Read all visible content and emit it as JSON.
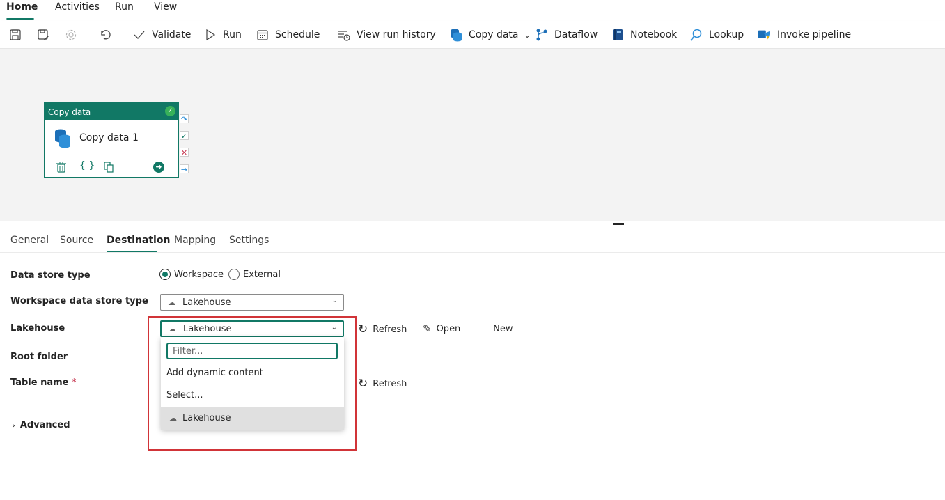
{
  "menubar": {
    "items": [
      {
        "label": "Home",
        "active": true
      },
      {
        "label": "Activities",
        "active": false
      },
      {
        "label": "Run",
        "active": false
      },
      {
        "label": "View",
        "active": false
      }
    ]
  },
  "toolbar": {
    "validate": "Validate",
    "run": "Run",
    "schedule": "Schedule",
    "view_run_history": "View run history",
    "copy_data": "Copy data",
    "dataflow": "Dataflow",
    "notebook": "Notebook",
    "lookup": "Lookup",
    "invoke_pipeline": "Invoke pipeline"
  },
  "canvas": {
    "activity": {
      "type_label": "Copy data",
      "name": "Copy data 1",
      "status": "succeeded"
    }
  },
  "tabs": [
    {
      "label": "General",
      "active": false
    },
    {
      "label": "Source",
      "active": false
    },
    {
      "label": "Destination",
      "active": true
    },
    {
      "label": "Mapping",
      "active": false
    },
    {
      "label": "Settings",
      "active": false
    }
  ],
  "form": {
    "data_store_type": {
      "label": "Data store type",
      "options": [
        "Workspace",
        "External"
      ],
      "selected": "Workspace"
    },
    "workspace_store_type": {
      "label": "Workspace data store type",
      "value": "Lakehouse"
    },
    "lakehouse": {
      "label": "Lakehouse",
      "value": "Lakehouse",
      "refresh": "Refresh",
      "open": "Open",
      "new": "New"
    },
    "root_folder": {
      "label": "Root folder"
    },
    "table_name": {
      "label": "Table name",
      "required_mark": "*",
      "refresh": "Refresh"
    },
    "advanced": {
      "label": "Advanced"
    }
  },
  "dropdown": {
    "filter_placeholder": "Filter...",
    "items": [
      {
        "label": "Add dynamic content"
      },
      {
        "label": "Select..."
      },
      {
        "label": "Lakehouse",
        "selected": true
      }
    ]
  },
  "colors": {
    "accent": "#117865",
    "highlight": "#d13438",
    "success": "#38b15a"
  }
}
